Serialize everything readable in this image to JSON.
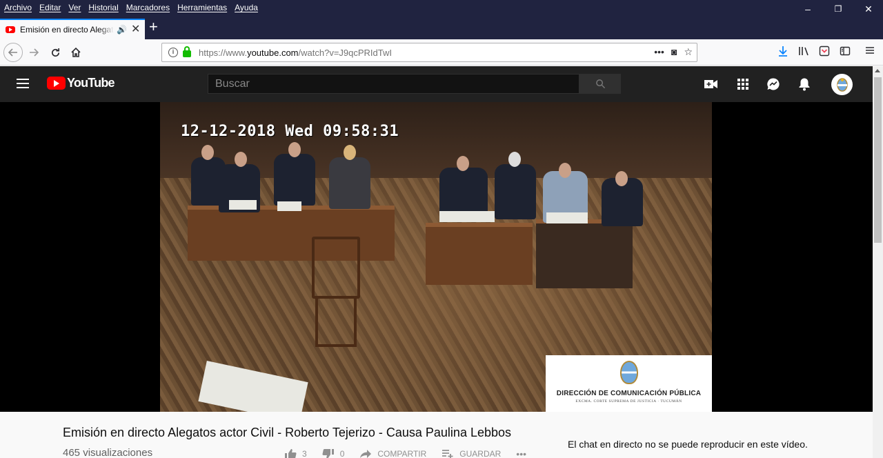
{
  "browser": {
    "menu": [
      "Archivo",
      "Editar",
      "Ver",
      "Historial",
      "Marcadores",
      "Herramientas",
      "Ayuda"
    ],
    "window_controls": {
      "minimize": "–",
      "restore": "❐",
      "close": "✕"
    },
    "tab": {
      "title": "Emisión en directo Alegatos",
      "favicon": "youtube-favicon",
      "audio_icon": "🔊",
      "close_icon": "✕"
    },
    "new_tab_label": "+",
    "url": {
      "prefix": "https://www.",
      "domain": "youtube.com",
      "path": "/watch?v=J9qcPRIdTwI"
    },
    "url_actions": {
      "more": "•••",
      "pocket": "◙",
      "bookmark": "☆"
    },
    "toolbar_icons": [
      "download-icon",
      "library-icon",
      "pocket-icon",
      "sidebar-icon",
      "menu-icon"
    ]
  },
  "youtube": {
    "logo_text": "YouTube",
    "search": {
      "placeholder": "Buscar"
    },
    "header_icons": [
      "create-video-icon",
      "apps-icon",
      "messages-icon",
      "notifications-icon",
      "account-avatar"
    ]
  },
  "player": {
    "timestamp": "12-12-2018 Wed 09:58:31",
    "watermark_title": "DIRECCIÓN DE COMUNICACIÓN PÚBLICA",
    "watermark_subtitle": "EXCMA. CORTE SUPREMA DE JUSTICIA · TUCUMÁN"
  },
  "video": {
    "title": "Emisión en directo Alegatos actor Civil - Roberto Tejerizo - Causa Paulina Lebbos",
    "views": "465 visualizaciones",
    "likes": "3",
    "dislikes": "0",
    "share_label": "COMPARTIR",
    "save_label": "GUARDAR",
    "more_label": "•••"
  },
  "chat": {
    "message": "El chat en directo no se puede reproducir en este vídeo."
  },
  "colors": {
    "chrome_dark": "#202340",
    "yt_header": "#212121",
    "yt_red": "#ff0000",
    "tab_accent": "#0a84ff"
  }
}
